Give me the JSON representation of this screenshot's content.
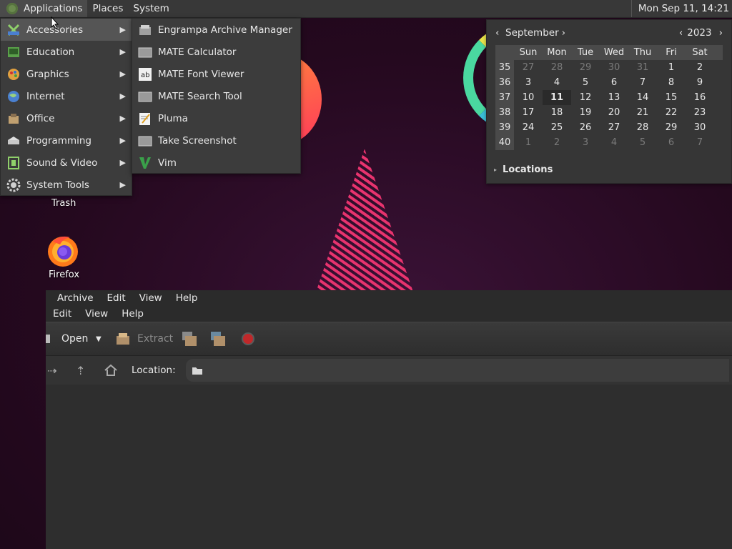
{
  "panel": {
    "applications_label": "Applications",
    "places_label": "Places",
    "system_label": "System",
    "clock": "Mon Sep 11, 14:21"
  },
  "apps_menu": {
    "items": [
      {
        "label": "Accessories",
        "icon": "accessories-icon"
      },
      {
        "label": "Education",
        "icon": "education-icon"
      },
      {
        "label": "Graphics",
        "icon": "graphics-icon"
      },
      {
        "label": "Internet",
        "icon": "internet-icon"
      },
      {
        "label": "Office",
        "icon": "office-icon"
      },
      {
        "label": "Programming",
        "icon": "programming-icon"
      },
      {
        "label": "Sound & Video",
        "icon": "sound-video-icon"
      },
      {
        "label": "System Tools",
        "icon": "system-tools-icon"
      }
    ]
  },
  "accessories_menu": {
    "items": [
      {
        "label": "Engrampa Archive Manager",
        "icon": "archive-icon"
      },
      {
        "label": "MATE Calculator",
        "icon": "calculator-icon"
      },
      {
        "label": "MATE Font Viewer",
        "icon": "font-icon"
      },
      {
        "label": "MATE Search Tool",
        "icon": "search-tool-icon"
      },
      {
        "label": "Pluma",
        "icon": "text-editor-icon"
      },
      {
        "label": "Take Screenshot",
        "icon": "screenshot-icon"
      },
      {
        "label": "Vim",
        "icon": "vim-icon"
      }
    ]
  },
  "calendar": {
    "month": "September",
    "year": "2023",
    "weekdays": [
      "Sun",
      "Mon",
      "Tue",
      "Wed",
      "Thu",
      "Fri",
      "Sat"
    ],
    "weeks": [
      {
        "num": "35",
        "days": [
          "27",
          "28",
          "29",
          "30",
          "31",
          "1",
          "2"
        ]
      },
      {
        "num": "36",
        "days": [
          "3",
          "4",
          "5",
          "6",
          "7",
          "8",
          "9"
        ]
      },
      {
        "num": "37",
        "days": [
          "10",
          "11",
          "12",
          "13",
          "14",
          "15",
          "16"
        ]
      },
      {
        "num": "38",
        "days": [
          "17",
          "18",
          "19",
          "20",
          "21",
          "22",
          "23"
        ]
      },
      {
        "num": "39",
        "days": [
          "24",
          "25",
          "26",
          "27",
          "28",
          "29",
          "30"
        ]
      },
      {
        "num": "40",
        "days": [
          "1",
          "2",
          "3",
          "4",
          "5",
          "6",
          "7"
        ]
      }
    ],
    "today": "11",
    "locations_label": "Locations"
  },
  "desktop": {
    "trash_label": "Trash",
    "firefox_label": "Firefox"
  },
  "engrampa": {
    "menubar_back": [
      "Archive",
      "Edit",
      "View",
      "Help"
    ],
    "menubar_front": [
      "Edit",
      "View",
      "Help"
    ],
    "open_label": "Open",
    "extract_label": "Extract",
    "location_label": "Location:"
  },
  "colors": {
    "panel_bg": "#383838",
    "menu_bg": "#3c3c3c",
    "menu_active": "#555555",
    "accent_pink": "#e8336e"
  }
}
